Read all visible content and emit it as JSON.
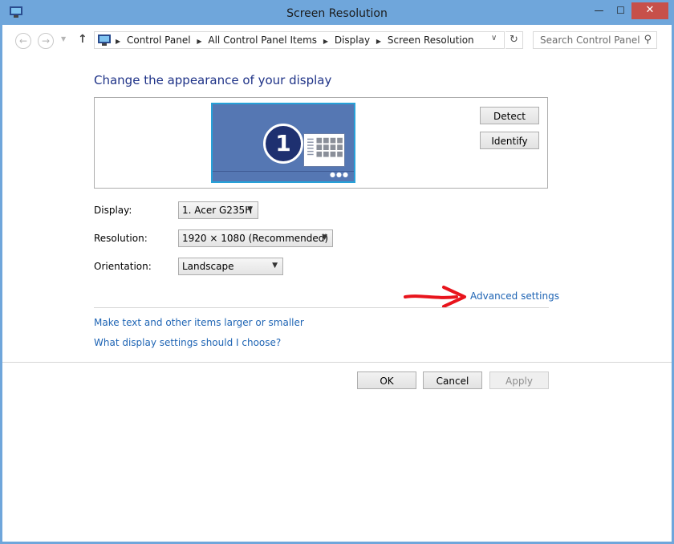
{
  "window": {
    "title": "Screen Resolution",
    "minimize_glyph": "—",
    "maximize_glyph": "☐",
    "close_glyph": "✕"
  },
  "nav": {
    "back_glyph": "←",
    "forward_glyph": "→",
    "recent_glyph": "▼",
    "up_glyph": "↑",
    "refresh_glyph": "↻",
    "breadcrumbs": [
      "Control Panel",
      "All Control Panel Items",
      "Display",
      "Screen Resolution"
    ],
    "search_placeholder": "Search Control Panel"
  },
  "main": {
    "heading": "Change the appearance of your display",
    "monitor_number": "1",
    "detect_label": "Detect",
    "identify_label": "Identify",
    "display_label": "Display:",
    "display_value": "1. Acer G235H",
    "resolution_label": "Resolution:",
    "resolution_value": "1920 × 1080 (Recommended)",
    "orientation_label": "Orientation:",
    "orientation_value": "Landscape",
    "advanced_link": "Advanced settings",
    "larger_link": "Make text and other items larger or smaller",
    "which_link": "What display settings should I choose?"
  },
  "footer": {
    "ok_label": "OK",
    "cancel_label": "Cancel",
    "apply_label": "Apply"
  },
  "colors": {
    "frame": "#6fa6db",
    "heading": "#1e3287",
    "link": "#1e64b4",
    "close": "#c7504a",
    "annotation_arrow": "#e8141c",
    "monitor_fill": "#5577b3"
  }
}
